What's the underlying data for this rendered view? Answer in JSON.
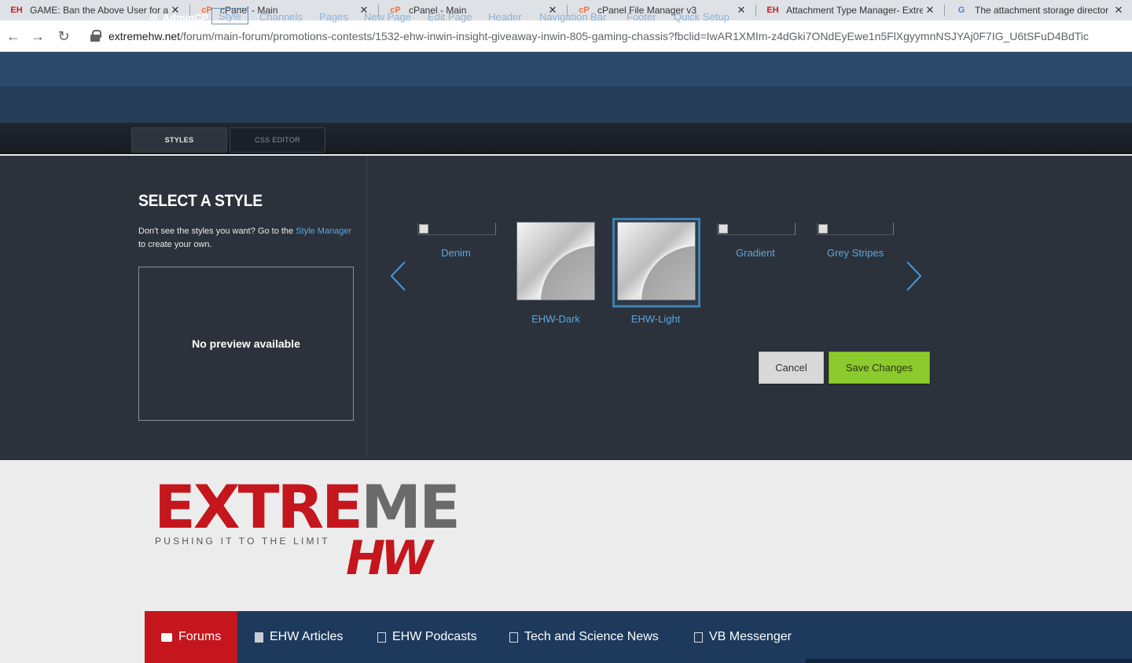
{
  "browser": {
    "tabs": [
      {
        "icon": "eh-favicon-icon",
        "label": "GAME: Ban the Above User for a"
      },
      {
        "icon": "cpanel-favicon-icon",
        "label": "cPanel - Main"
      },
      {
        "icon": "cpanel-favicon-icon",
        "label": "cPanel - Main"
      },
      {
        "icon": "cpanel-favicon-icon",
        "label": "cPanel File Manager v3"
      },
      {
        "icon": "eh-favicon-icon",
        "label": "Attachment Type Manager- Extre"
      },
      {
        "icon": "google-favicon-icon",
        "label": "The attachment storage director"
      }
    ],
    "favicon_text": {
      "eh": "EH",
      "cp": "cP",
      "g": "G"
    },
    "close_glyph": "✕",
    "nav": {
      "back": "←",
      "forward": "→",
      "reload": "↻"
    },
    "url_host": "extremehw.net",
    "url_path": "/forum/main-forum/promotions-contests/1532-ehw-inwin-insight-giveaway-inwin-805-gaming-chassis?fbclid=IwAR1XMIm-z4dGki7ONdEyEwe1n5FlXgyymnNSJYAj0F7IG_U6tSFuD4BdTic"
  },
  "admin": {
    "brand": "AdminCP",
    "gear": "✲",
    "nav": [
      "Style",
      "Channels",
      "Pages",
      "New Page",
      "Edit Page",
      "Header",
      "Navigation Bar",
      "Footer",
      "Quick Setup"
    ],
    "active_nav": "Style"
  },
  "style_tabs": {
    "styles": "STYLES",
    "css_editor": "CSS EDITOR"
  },
  "style_panel": {
    "title": "SELECT A STYLE",
    "desc_before": "Don't see the styles you want? Go to the ",
    "desc_link": "Style Manager",
    "desc_after": " to create your own.",
    "preview_text": "No preview available",
    "styles": [
      "Denim",
      "EHW-Dark",
      "EHW-Light",
      "Gradient",
      "Grey Stripes"
    ],
    "selected_style": "EHW-Light",
    "cancel_label": "Cancel",
    "save_label": "Save Changes",
    "colors": {
      "link": "#5aa7e0",
      "save": "#8ccb2d",
      "selection_border": "#3f7fb0"
    }
  },
  "site": {
    "logo_word_red": "EXTRE",
    "logo_word_grey": "ME",
    "logo_tagline": "PUSHING IT TO THE LIMIT",
    "logo_hw": "HW",
    "nav": [
      "Forums",
      "EHW Articles",
      "EHW Podcasts",
      "Tech and Science News",
      "VB Messenger"
    ],
    "active_nav": "Forums",
    "colors": {
      "brand_red": "#c4161c",
      "nav_bg": "#1d3a5c"
    }
  }
}
